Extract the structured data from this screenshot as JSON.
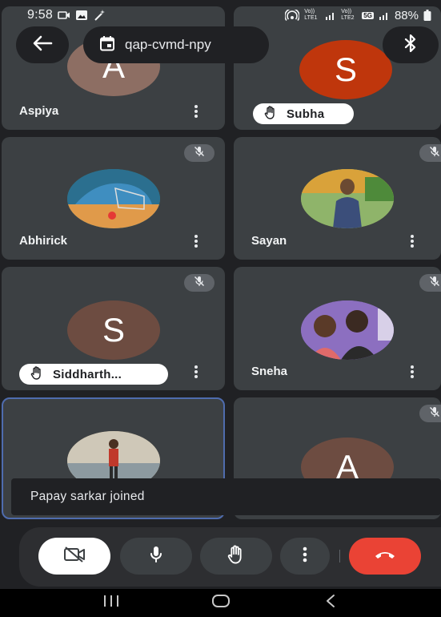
{
  "status_bar": {
    "time": "9:58",
    "carrier1": "Vo)) LTE1",
    "carrier2": "Vo)) LTE2",
    "network": "5G",
    "battery": "88%"
  },
  "top_bar": {
    "meeting_code": "qap-cvmd-npy"
  },
  "participants": [
    {
      "name": "Aspiya",
      "initial": "A",
      "avatar_color": "#8d6e63",
      "hand_raised": false,
      "muted": false
    },
    {
      "name": "Subha",
      "initial": "S",
      "avatar_color": "#bf360c",
      "hand_raised": true,
      "muted": false
    },
    {
      "name": "Abhirick",
      "initial": "",
      "avatar_color": "#2e7d6a",
      "hand_raised": false,
      "muted": true
    },
    {
      "name": "Sayan",
      "initial": "",
      "avatar_color": "#7a8a4a",
      "hand_raised": false,
      "muted": true
    },
    {
      "name": "Siddharth...",
      "initial": "S",
      "avatar_color": "#6d4c41",
      "hand_raised": true,
      "muted": true
    },
    {
      "name": "Sneha",
      "initial": "",
      "avatar_color": "#7b5ea7",
      "hand_raised": false,
      "muted": true
    },
    {
      "name": "",
      "initial": "",
      "avatar_color": "#8a7a5a",
      "hand_raised": false,
      "muted": false,
      "active_speaker": true
    },
    {
      "name": "",
      "initial": "A",
      "avatar_color": "#6d4c41",
      "hand_raised": false,
      "muted": true
    }
  ],
  "toast": {
    "message": "Papay sarkar joined"
  },
  "controls": {
    "camera": "camera-off-icon",
    "mic": "mic-icon",
    "hand": "raise-hand-icon",
    "more": "more-vert-icon",
    "end_call": "call-end-icon",
    "end_color": "#ea4335"
  },
  "nav": {
    "recents": "recents-icon",
    "home": "home-icon",
    "back": "back-icon"
  }
}
